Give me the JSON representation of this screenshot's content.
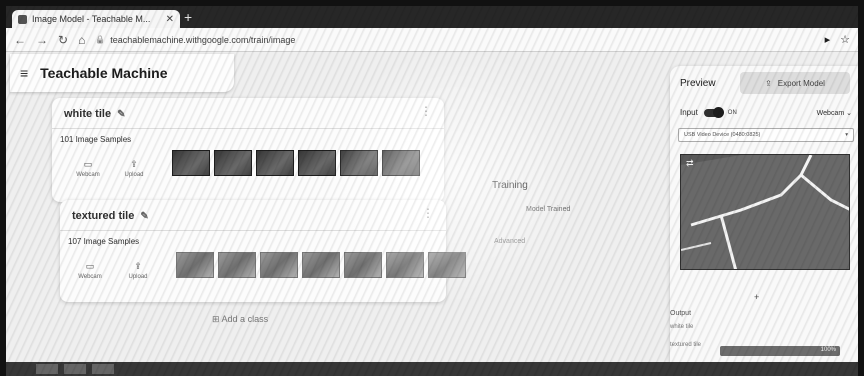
{
  "browser": {
    "tab_title": "Image Model - Teachable M...",
    "url": "teachablemachine.withgoogle.com/train/image"
  },
  "app": {
    "title": "Teachable Machine"
  },
  "classes": [
    {
      "name": "white tile",
      "samples_label": "101 Image Samples",
      "webcam_label": "Webcam",
      "upload_label": "Upload"
    },
    {
      "name": "textured tile",
      "samples_label": "107 Image Samples",
      "webcam_label": "Webcam",
      "upload_label": "Upload"
    }
  ],
  "add_class_label": "Add a class",
  "training": {
    "title": "Training",
    "status": "Model Trained",
    "advanced_label": "Advanced"
  },
  "preview": {
    "title": "Preview",
    "export_label": "Export Model",
    "input_label": "Input",
    "on_label": "ON",
    "source_label": "Webcam",
    "device_label": "USB Video Device (0480:0825)",
    "output_label": "Output",
    "outputs": [
      {
        "label": "white tile",
        "value": 0
      },
      {
        "label": "textured tile",
        "value": 100,
        "value_label": "100%"
      }
    ]
  }
}
